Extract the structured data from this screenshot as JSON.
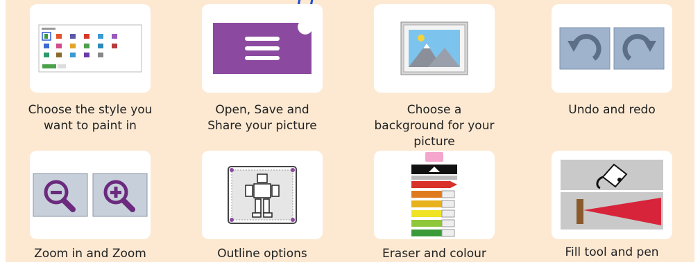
{
  "header_fragment": "ƒ ƒ",
  "row1": [
    {
      "label_lines": [
        "Choose the style you",
        "want to paint in"
      ]
    },
    {
      "label_lines": [
        "Open, Save and",
        "Share your picture"
      ]
    },
    {
      "label_lines": [
        "Choose a",
        "background for your",
        "picture"
      ]
    },
    {
      "label_lines": [
        "Undo and redo"
      ]
    }
  ],
  "row2": [
    {
      "label_lines": [
        "Zoom in and Zoom"
      ]
    },
    {
      "label_lines": [
        "Outline options"
      ]
    },
    {
      "label_lines": [
        "Eraser and colour"
      ]
    },
    {
      "label_lines": [
        "Fill tool and pen"
      ]
    }
  ],
  "colors": {
    "panel_bg": "#fde9d2",
    "card_bg": "#ffffff",
    "menu_purple": "#8b4aa0",
    "undo_blue": "#9fb3cc",
    "zoom_bg": "#c7cfdb",
    "zoom_icon": "#6b2a7d"
  }
}
